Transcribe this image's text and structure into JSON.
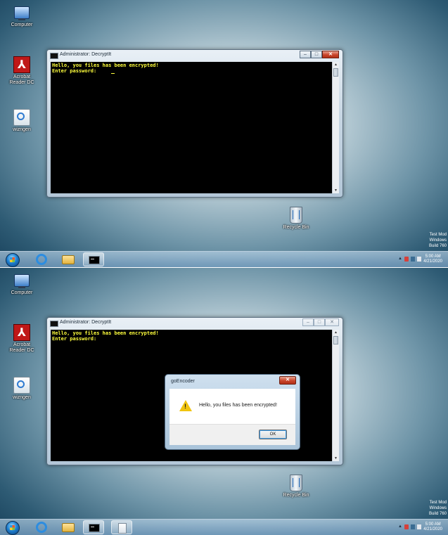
{
  "desktop": {
    "icons": [
      {
        "id": "computer",
        "label": "Computer",
        "icon": "computer-icon"
      },
      {
        "id": "acrobat",
        "label": "Acrobat Reader DC",
        "icon": "acrobat-reader-icon"
      },
      {
        "id": "wizard",
        "label": "wizngen",
        "icon": "setup-wizard-icon"
      },
      {
        "id": "recycle",
        "label": "Recycle Bin",
        "icon": "recycle-bin-icon"
      }
    ],
    "watermark": [
      "Test Mod",
      "Windows",
      "Build 760"
    ]
  },
  "console_window": {
    "title": "Administrator: DecryptIt",
    "lines": [
      "Hello, you files has been encrypted!",
      "Enter password: "
    ],
    "buttons": {
      "minimize": "–",
      "maximize": "□",
      "close": "✕"
    }
  },
  "dialog": {
    "title": "goEncoder",
    "message": "Hello, you files has been encrypted!",
    "ok_label": "OK",
    "close_label": "✕",
    "icon": "warning-icon"
  },
  "taskbar": {
    "pinned": [
      "start-orb",
      "internet-explorer-icon",
      "explorer-folder-icon",
      "cmd-icon"
    ],
    "tray_arrow": "▲",
    "clock_time": "5:00 AM",
    "clock_date": "4/21/2020"
  },
  "colors": {
    "console_text": "#ffff3c",
    "console_bg": "#000000",
    "close_button": "#c9462c"
  }
}
